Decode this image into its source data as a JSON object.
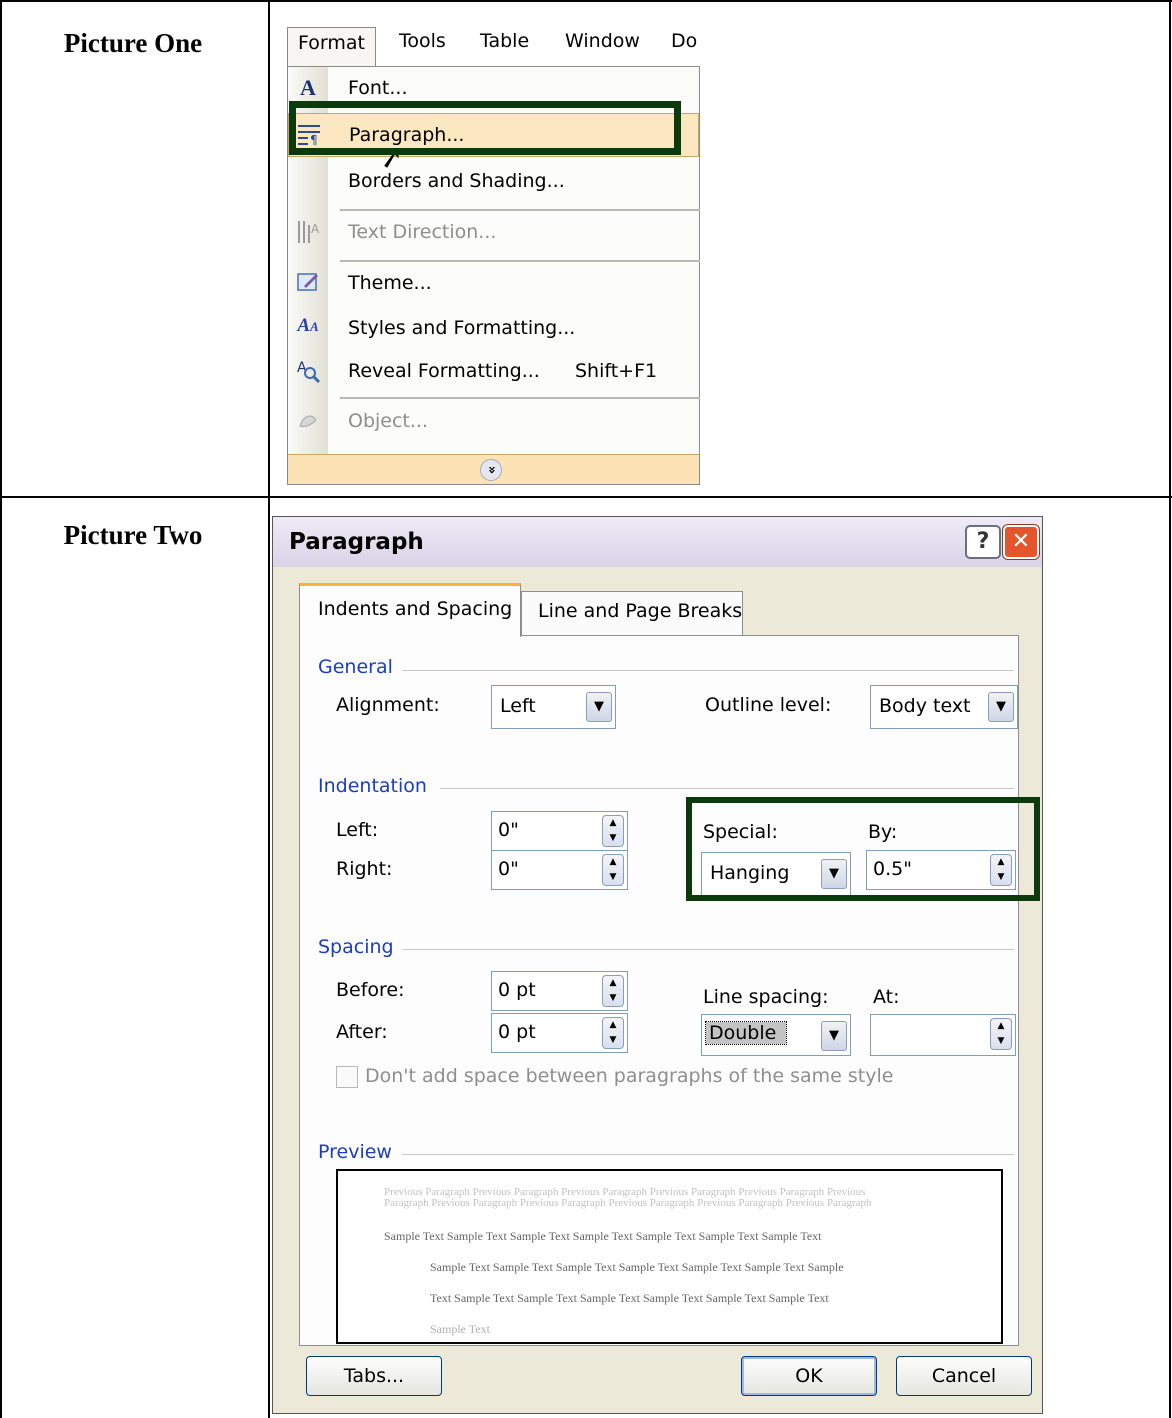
{
  "labels": {
    "picture_one": "Picture One",
    "picture_two": "Picture Two"
  },
  "menubar": {
    "items": [
      "Format",
      "Tools",
      "Table",
      "Window",
      "Do"
    ]
  },
  "format_menu": {
    "items": [
      {
        "label": "Font...",
        "icon": "font-icon",
        "enabled": true
      },
      {
        "label": "Paragraph...",
        "icon": "paragraph-icon",
        "enabled": true,
        "highlighted": true
      },
      {
        "label": "Borders and Shading...",
        "icon": "",
        "enabled": true
      },
      {
        "label": "Text Direction...",
        "icon": "text-direction-icon",
        "enabled": false
      },
      {
        "label": "Theme...",
        "icon": "theme-icon",
        "enabled": true
      },
      {
        "label": "Styles and Formatting...",
        "icon": "styles-icon",
        "enabled": true
      },
      {
        "label": "Reveal Formatting...",
        "shortcut": "Shift+F1",
        "icon": "reveal-formatting-icon",
        "enabled": true
      },
      {
        "label": "Object...",
        "icon": "object-icon",
        "enabled": false
      }
    ],
    "expand_glyph": "»"
  },
  "dialog": {
    "title": "Paragraph",
    "help_glyph": "?",
    "close_glyph": "✕",
    "tabs": [
      "Indents and Spacing",
      "Line and Page Breaks"
    ],
    "general": {
      "heading": "General",
      "alignment_label": "Alignment:",
      "alignment_value": "Left",
      "outline_label": "Outline level:",
      "outline_value": "Body text"
    },
    "indentation": {
      "heading": "Indentation",
      "left_label": "Left:",
      "left_value": "0\"",
      "right_label": "Right:",
      "right_value": "0\"",
      "special_label": "Special:",
      "special_value": "Hanging",
      "by_label": "By:",
      "by_value": "0.5\""
    },
    "spacing": {
      "heading": "Spacing",
      "before_label": "Before:",
      "before_value": "0 pt",
      "after_label": "After:",
      "after_value": "0 pt",
      "line_spacing_label": "Line spacing:",
      "line_spacing_value": "Double",
      "at_label": "At:",
      "at_value": "",
      "dont_add_space_label": "Don't add space between paragraphs of the same style"
    },
    "preview": {
      "heading": "Preview",
      "previous_text": "Previous Paragraph Previous Paragraph Previous Paragraph Previous Paragraph Previous Paragraph Previous Paragraph Previous Paragraph Previous Paragraph Previous Paragraph Previous Paragraph Previous Paragraph",
      "sample_lines": [
        "Sample Text Sample Text Sample Text Sample Text Sample Text Sample Text Sample Text",
        "Sample Text Sample Text Sample Text Sample Text Sample Text Sample Text Sample",
        "Text Sample Text Sample Text Sample Text Sample Text Sample Text Sample Text",
        "Sample Text"
      ]
    },
    "buttons": {
      "tabs": "Tabs...",
      "ok": "OK",
      "cancel": "Cancel"
    }
  },
  "colors": {
    "focus_box": "#0c3a0c",
    "menu_highlight": "#fbe8c0",
    "group_heading": "#1a3ec0"
  }
}
